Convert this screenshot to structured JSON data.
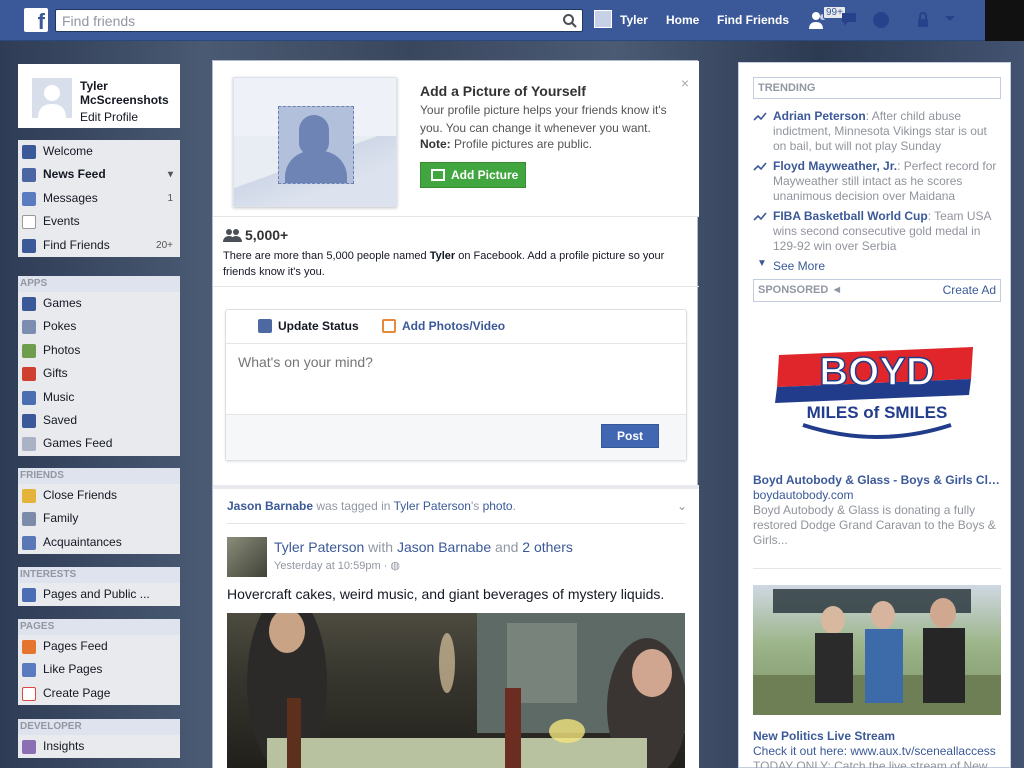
{
  "topbar": {
    "search_placeholder": "Find friends",
    "user_name": "Tyler",
    "home_label": "Home",
    "find_friends_label": "Find Friends",
    "friend_requests_count": "99+"
  },
  "profile": {
    "name": "Tyler McScreenshots",
    "edit_label": "Edit Profile"
  },
  "nav": {
    "main": [
      {
        "label": "Welcome",
        "icon": "welcome-icon",
        "count": ""
      },
      {
        "label": "News Feed",
        "icon": "news-feed-icon",
        "count": ""
      },
      {
        "label": "Messages",
        "icon": "messages-icon",
        "count": "1"
      },
      {
        "label": "Events",
        "icon": "events-icon",
        "count": ""
      },
      {
        "label": "Find Friends",
        "icon": "find-friends-icon",
        "count": "20+"
      }
    ],
    "apps_header": "APPS",
    "apps": [
      {
        "label": "Games",
        "icon": "games-icon"
      },
      {
        "label": "Pokes",
        "icon": "pokes-icon"
      },
      {
        "label": "Photos",
        "icon": "photos-icon"
      },
      {
        "label": "Gifts",
        "icon": "gifts-icon"
      },
      {
        "label": "Music",
        "icon": "music-icon"
      },
      {
        "label": "Saved",
        "icon": "saved-icon"
      },
      {
        "label": "Games Feed",
        "icon": "games-feed-icon"
      }
    ],
    "friends_header": "FRIENDS",
    "friends": [
      {
        "label": "Close Friends",
        "icon": "close-friends-icon"
      },
      {
        "label": "Family",
        "icon": "family-icon"
      },
      {
        "label": "Acquaintances",
        "icon": "acquaintances-icon"
      }
    ],
    "interests_header": "INTERESTS",
    "interests": [
      {
        "label": "Pages and Public ...",
        "icon": "pages-public-icon"
      }
    ],
    "pages_header": "PAGES",
    "pages": [
      {
        "label": "Pages Feed",
        "icon": "pages-feed-icon"
      },
      {
        "label": "Like Pages",
        "icon": "like-pages-icon"
      },
      {
        "label": "Create Page",
        "icon": "create-page-icon"
      }
    ],
    "developer_header": "DEVELOPER",
    "developer": [
      {
        "label": "Insights",
        "icon": "insights-icon"
      }
    ]
  },
  "add_picture": {
    "title": "Add a Picture of Yourself",
    "description": "Your profile picture helps your friends know it's you. You can change it whenever you want.",
    "note_label": "Note:",
    "note_text": " Profile pictures are public.",
    "button_label": "Add Picture",
    "close": "×"
  },
  "people": {
    "count": "5,000+",
    "desc_before": "There are more than 5,000 people named ",
    "desc_name": "Tyler",
    "desc_after": " on Facebook. Add a profile picture so your friends know it's you."
  },
  "composer": {
    "tab_status": "Update Status",
    "tab_photo": "Add Photos/Video",
    "placeholder": "What's on your mind?",
    "post_label": "Post"
  },
  "story": {
    "tagger": "Jason Barnabe",
    "was_tagged": " was tagged in ",
    "owner_link": "Tyler Paterson",
    "possessive": "'s ",
    "photo_link": "photo",
    "period": ".",
    "author": "Tyler Paterson",
    "with": " with ",
    "with_person": "Jason Barnabe",
    "and": " and ",
    "others": "2 others",
    "time": "Yesterday at 10:59pm · ",
    "text": "Hovercraft cakes, weird music, and giant beverages of mystery liquids."
  },
  "trending": {
    "header": "TRENDING",
    "items": [
      {
        "topic": "Adrian Peterson",
        "text": ": After child abuse indictment, Minnesota Vikings star is out on bail, but will not play Sunday"
      },
      {
        "topic": "Floyd Mayweather, Jr.",
        "text": ": Perfect record for Mayweather still intact as he scores unanimous decision over Maidana"
      },
      {
        "topic": "FIBA Basketball World Cup",
        "text": ": Team USA wins second consecutive gold medal in 129-92 win over Serbia"
      }
    ],
    "see_more": "See More"
  },
  "sponsored": {
    "header": "SPONSORED",
    "create_ad": "Create Ad",
    "ad1": {
      "logo_top": "BOYD",
      "logo_bottom": "MILES of SMILES",
      "title": "Boyd Autobody & Glass - Boys & Girls Clu...",
      "domain": "boydautobody.com",
      "desc": "Boyd Autobody & Glass is donating a fully restored Dodge Grand Caravan to the Boys & Girls..."
    },
    "ad2": {
      "title": "New Politics Live Stream",
      "domain": "Check it out here: www.aux.tv/sceneallaccess",
      "desc": "TODAY ONLY: Catch the live stream of New"
    }
  },
  "colors": {
    "brand": "#3b5998",
    "add_button": "#42a640",
    "post_button": "#4267b2"
  }
}
